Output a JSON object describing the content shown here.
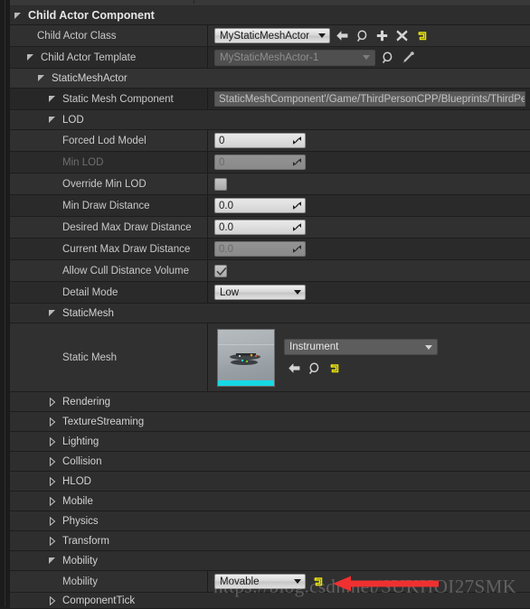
{
  "panel": {
    "title": "Child Actor Component"
  },
  "rows": {
    "child_actor_class": {
      "label": "Child Actor Class",
      "value": "MyStaticMeshActor"
    },
    "child_actor_template": {
      "label": "Child Actor Template",
      "value": "MyStaticMeshActor-1"
    },
    "static_mesh_actor": {
      "label": "StaticMeshActor"
    },
    "static_mesh_component": {
      "label": "Static Mesh Component",
      "value": "StaticMeshComponent'/Game/ThirdPersonCPP/Blueprints/ThirdPers"
    },
    "lod": {
      "label": "LOD"
    },
    "forced_lod_model": {
      "label": "Forced Lod Model",
      "value": "0"
    },
    "min_lod": {
      "label": "Min LOD",
      "value": "0"
    },
    "override_min_lod": {
      "label": "Override Min LOD",
      "checked": false
    },
    "min_draw_distance": {
      "label": "Min Draw Distance",
      "value": "0.0"
    },
    "desired_max_draw_distance": {
      "label": "Desired Max Draw Distance",
      "value": "0.0"
    },
    "current_max_draw_distance": {
      "label": "Current Max Draw Distance",
      "value": "0.0"
    },
    "allow_cull_distance_volume": {
      "label": "Allow Cull Distance Volume",
      "checked": true
    },
    "detail_mode": {
      "label": "Detail Mode",
      "value": "Low"
    },
    "static_mesh_group": {
      "label": "StaticMesh"
    },
    "static_mesh": {
      "label": "Static Mesh",
      "value": "Instrument"
    },
    "mobility_group": {
      "label": "Mobility"
    },
    "mobility": {
      "label": "Mobility",
      "value": "Movable"
    }
  },
  "collapsed_categories": [
    {
      "label": "Rendering"
    },
    {
      "label": "TextureStreaming"
    },
    {
      "label": "Lighting"
    },
    {
      "label": "Collision"
    },
    {
      "label": "HLOD"
    },
    {
      "label": "Mobile"
    },
    {
      "label": "Physics"
    },
    {
      "label": "Transform"
    }
  ],
  "component_tick": {
    "label": "ComponentTick"
  },
  "icons": {
    "back": "back-arrow-icon",
    "browse": "browse-magnifier-icon",
    "add": "plus-icon",
    "clear": "clear-x-icon",
    "reset": "reset-to-default-icon",
    "eyedropper": "eyedropper-icon"
  },
  "watermark": {
    "text": "https://blog.csdn.net/SUKHOI27SMK"
  },
  "colors": {
    "reset_yellow": "#e8e20a",
    "accent_cyan": "#17d8e4",
    "arrow_red": "#f03030",
    "panel_bg": "#242424",
    "header_bg": "#2d2d2d"
  }
}
